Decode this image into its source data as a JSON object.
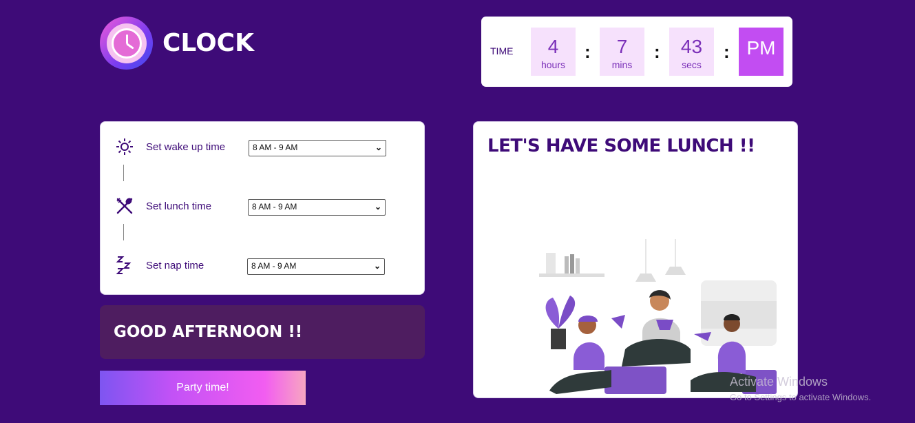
{
  "app": {
    "title": "CLOCK",
    "logo_icon": "clock-icon"
  },
  "clock": {
    "label": "TIME",
    "hours": "4",
    "hours_label": "hours",
    "mins": "7",
    "mins_label": "mins",
    "secs": "43",
    "secs_label": "secs",
    "separator": ":",
    "meridiem": "PM"
  },
  "settings": {
    "rows": [
      {
        "icon": "sun-icon",
        "label": "Set wake up time",
        "value": "8 AM - 9 AM"
      },
      {
        "icon": "fork-spoon-icon",
        "label": "Set lunch time",
        "value": "8 AM - 9 AM"
      },
      {
        "icon": "sleep-zzz-icon",
        "label": "Set nap time",
        "value": "8 AM - 9 AM"
      }
    ]
  },
  "greeting": "GOOD AFTERNOON !!",
  "party_button": "Party time!",
  "lunch_card": {
    "heading": "LET'S HAVE SOME LUNCH !!"
  },
  "watermark": {
    "line1": "Activate Windows",
    "line2": "Go to Settings to activate Windows."
  },
  "colors": {
    "background": "#3e0b78",
    "accent": "#c24df2",
    "unit_bg": "#f6e1fc",
    "greeting_bg": "#4e1d60"
  }
}
